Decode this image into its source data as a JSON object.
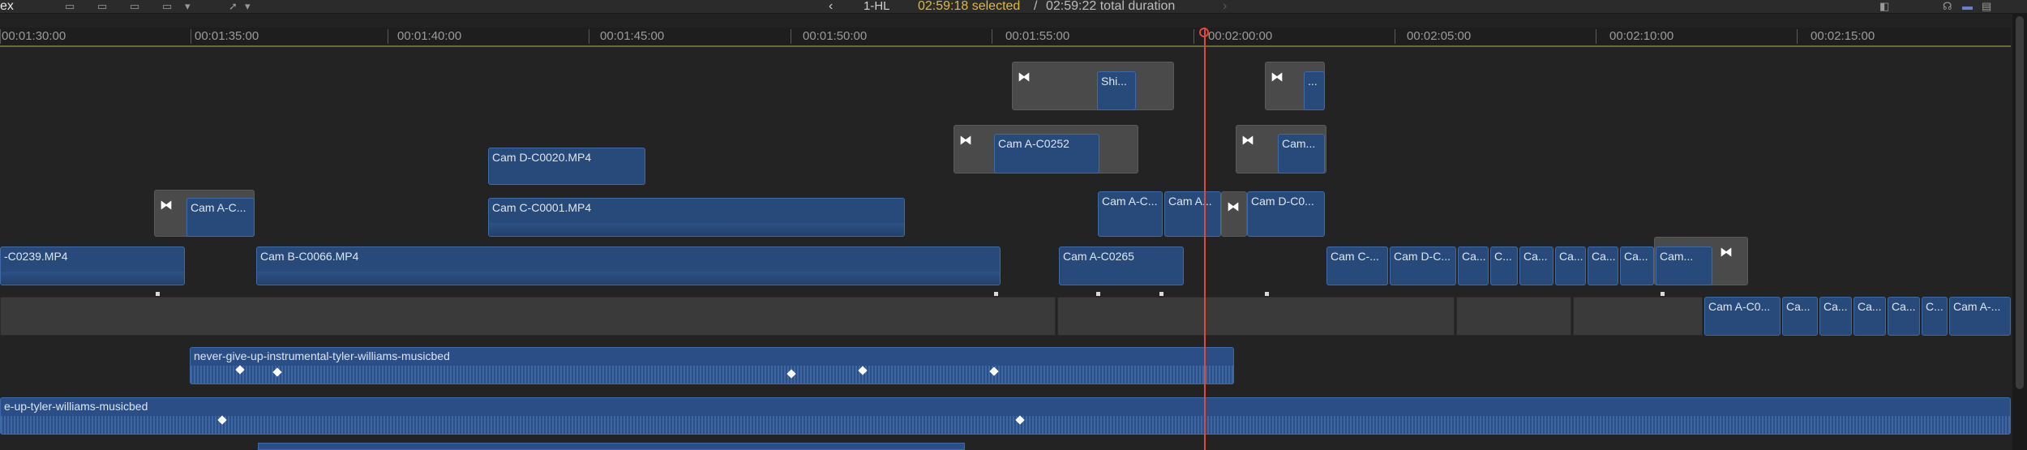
{
  "toolbar": {
    "library_label": "ex",
    "nav_back": "‹",
    "nav_forward": "›",
    "project_name": "1-HL",
    "selected_duration": "02:59:18 selected",
    "separator": " / ",
    "total_duration": "02:59:22 total duration",
    "accent_color": "#e0b93a"
  },
  "ruler": {
    "ticks": [
      "00:01:30:00",
      "00:01:35:00",
      "00:01:40:00",
      "00:01:45:00",
      "00:01:50:00",
      "00:01:55:00",
      "00:02:00:00",
      "00:02:05:00",
      "00:02:10:00",
      "00:02:15:00"
    ]
  },
  "clips": {
    "c1": "Shi...",
    "c2": "...",
    "c3": "Cam A-C0252",
    "c4": "Cam...",
    "c5": "Cam D-C0020.MP4",
    "c6": "Cam C-C0001.MP4",
    "c7": "Cam A-C...",
    "c8": "Cam A-C...",
    "c9": "Cam A...",
    "c10": "Cam D-C0...",
    "c11": "-C0239.MP4",
    "c12": "Cam B-C0066.MP4",
    "c13": "Cam A-C0265",
    "c14": "Cam C-...",
    "c15": "Cam D-C...",
    "c16": "Ca...",
    "c17": "C...",
    "c18": "Ca...",
    "c19": "Ca...",
    "c20": "Ca...",
    "c21": "Ca...",
    "c22": "Cam...",
    "c23": "Cam A-C0...",
    "c24": "Ca...",
    "c25": "Ca...",
    "c26": "Ca...",
    "c27": "Ca...",
    "c28": "C...",
    "c29": "Cam A-..."
  },
  "audio": {
    "a1": "never-give-up-instrumental-tyler-williams-musicbed",
    "a2": "e-up-tyler-williams-musicbed"
  },
  "colors": {
    "clip": "#284a7a",
    "playhead": "#e0483a",
    "gap": "#3a3a3a"
  }
}
